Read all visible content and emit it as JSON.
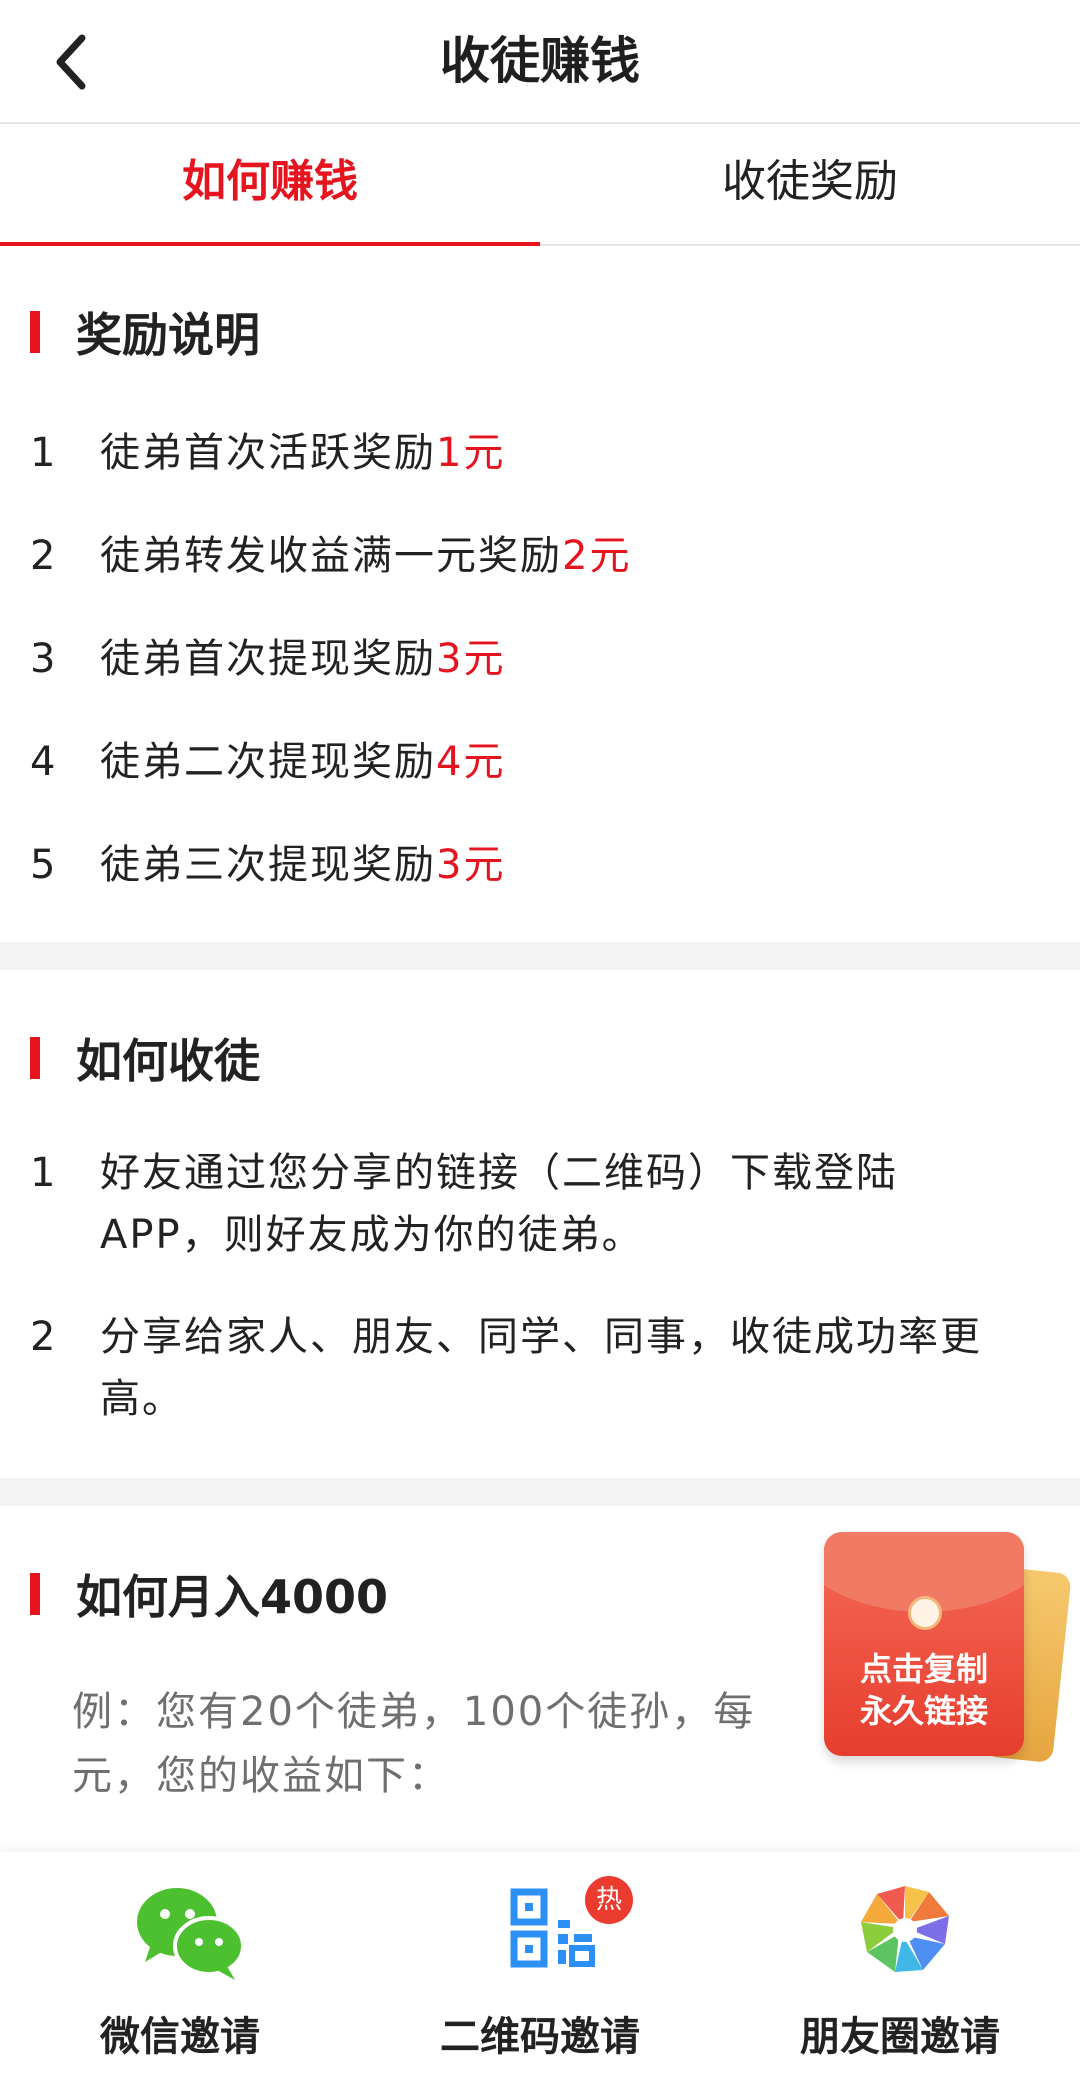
{
  "header": {
    "title": "收徒赚钱"
  },
  "tabs": [
    {
      "label": "如何赚钱",
      "active": true
    },
    {
      "label": "收徒奖励",
      "active": false
    }
  ],
  "reward_section": {
    "title": "奖励说明",
    "items": [
      {
        "num": "1",
        "text": "徒弟首次活跃奖励",
        "amount": "1元"
      },
      {
        "num": "2",
        "text": "徒弟转发收益满一元奖励",
        "amount": "2元"
      },
      {
        "num": "3",
        "text": "徒弟首次提现奖励",
        "amount": "3元"
      },
      {
        "num": "4",
        "text": "徒弟二次提现奖励",
        "amount": "4元"
      },
      {
        "num": "5",
        "text": "徒弟三次提现奖励",
        "amount": "3元"
      }
    ]
  },
  "how_section": {
    "title": "如何收徒",
    "items": [
      {
        "num": "1",
        "text": "好友通过您分享的链接（二维码）下载登陆APP，则好友成为你的徒弟。"
      },
      {
        "num": "2",
        "text": "分享给家人、朋友、同学、同事，收徒成功率更高。"
      }
    ]
  },
  "monthly_section": {
    "title": "如何月入4000",
    "example": "例：您有20个徒弟，100个徒孙，每",
    "example_line2": "元，您的收益如下："
  },
  "envelope": {
    "line1": "点击复制",
    "line2": "永久链接"
  },
  "bottom_actions": [
    {
      "label": "微信邀请",
      "icon": "wechat-icon"
    },
    {
      "label": "二维码邀请",
      "icon": "qrcode-icon",
      "badge": "热"
    },
    {
      "label": "朋友圈邀请",
      "icon": "moments-icon"
    }
  ],
  "colors": {
    "accent": "#e5141e",
    "divider": "#f4f4f4",
    "wechat": "#4cc02f",
    "qr": "#2b8ff6"
  }
}
